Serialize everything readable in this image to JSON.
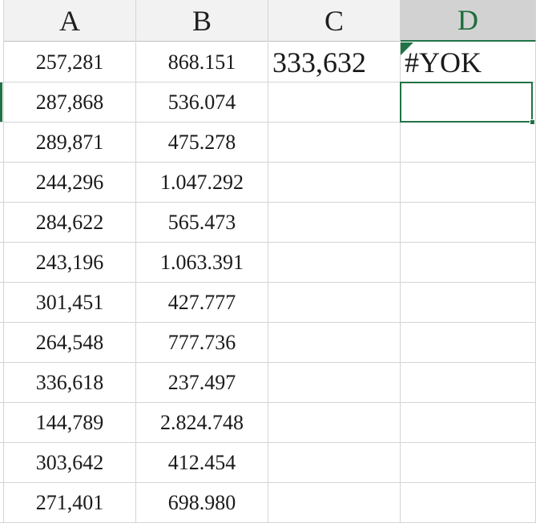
{
  "columns": [
    "A",
    "B",
    "C",
    "D"
  ],
  "selected_column": "D",
  "rows": [
    {
      "a": "257,281",
      "b": "868.151",
      "c": "333,632",
      "d": "#YOK"
    },
    {
      "a": "287,868",
      "b": "536.074",
      "c": "",
      "d": ""
    },
    {
      "a": "289,871",
      "b": "475.278",
      "c": "",
      "d": ""
    },
    {
      "a": "244,296",
      "b": "1.047.292",
      "c": "",
      "d": ""
    },
    {
      "a": "284,622",
      "b": "565.473",
      "c": "",
      "d": ""
    },
    {
      "a": "243,196",
      "b": "1.063.391",
      "c": "",
      "d": ""
    },
    {
      "a": "301,451",
      "b": "427.777",
      "c": "",
      "d": ""
    },
    {
      "a": "264,548",
      "b": "777.736",
      "c": "",
      "d": ""
    },
    {
      "a": "336,618",
      "b": "237.497",
      "c": "",
      "d": ""
    },
    {
      "a": "144,789",
      "b": "2.824.748",
      "c": "",
      "d": ""
    },
    {
      "a": "303,642",
      "b": "412.454",
      "c": "",
      "d": ""
    },
    {
      "a": "271,401",
      "b": "698.980",
      "c": "",
      "d": ""
    }
  ],
  "colors": {
    "accent": "#217346",
    "gridline": "#d4d4d4",
    "header_bg": "#f2f2f2",
    "selected_header_bg": "#d2d2d2",
    "selected_header_text": "#1e6e3d"
  },
  "icons": {
    "error_indicator": "green-triangle-icon",
    "fill_handle": "fill-handle-icon"
  }
}
